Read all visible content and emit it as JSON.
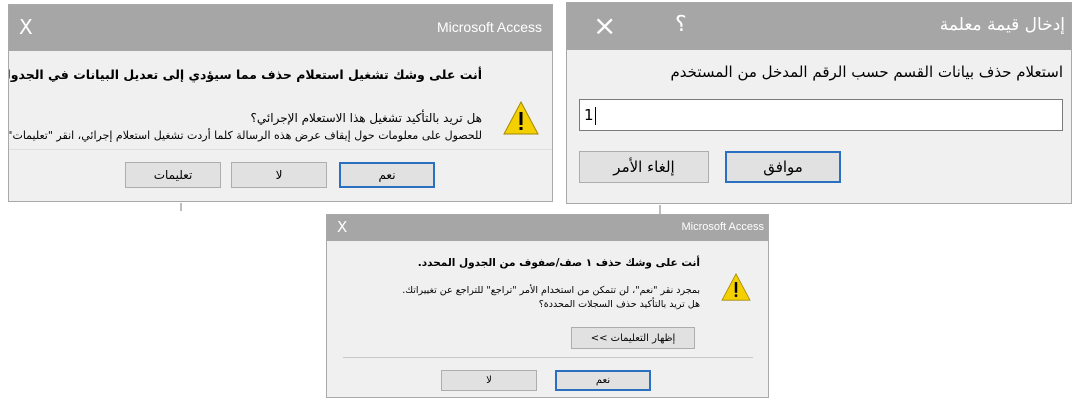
{
  "dialog_delete_confirm": {
    "close_glyph": "X",
    "app_title": "Microsoft Access",
    "message_main": "أنت على وشك تشغيل استعلام حذف مما سيؤدي إلى تعديل البيانات في الجدول.",
    "message_question": "هل تريد بالتأكيد تشغيل هذا الاستعلام الإجرائي؟",
    "message_info": "للحصول على معلومات حول إيقاف عرض هذه الرسالة كلما أردت تشغيل استعلام إجرائي، انقر \"تعليمات\".",
    "yes_label": "نعم",
    "no_label": "لا",
    "help_label": "تعليمات"
  },
  "dialog_parameter": {
    "close_glyph": "×",
    "help_glyph": "؟",
    "title": "إدخال قيمة معلمة",
    "prompt": "استعلام حذف بيانات القسم حسب الرقم المدخل من المستخدم",
    "input_value": "1",
    "ok_label": "موافق",
    "cancel_label": "إلغاء الأمر"
  },
  "dialog_rows_delete": {
    "close_glyph": "X",
    "app_title": "Microsoft Access",
    "message_main": "أنت على وشك حذف ١ صف/صفوف من الجدول المحدد.",
    "message_detail_1": "بمجرد نقر \"نعم\"، لن تتمكن من استخدام الأمر \"تراجع\" للتراجع عن تغييراتك.",
    "message_detail_2": "هل تريد بالتأكيد حذف السجلات المحددة؟",
    "show_help_label": "إظهار التعليمات >>",
    "yes_label": "نعم",
    "no_label": "لا"
  },
  "icons": {
    "warning": "warning-icon",
    "close": "close-icon",
    "help": "help-icon"
  },
  "colors": {
    "titlebar_gray": "#a6a6a6",
    "default_button_border": "#2b6fc0",
    "warning_yellow": "#f5d000"
  }
}
